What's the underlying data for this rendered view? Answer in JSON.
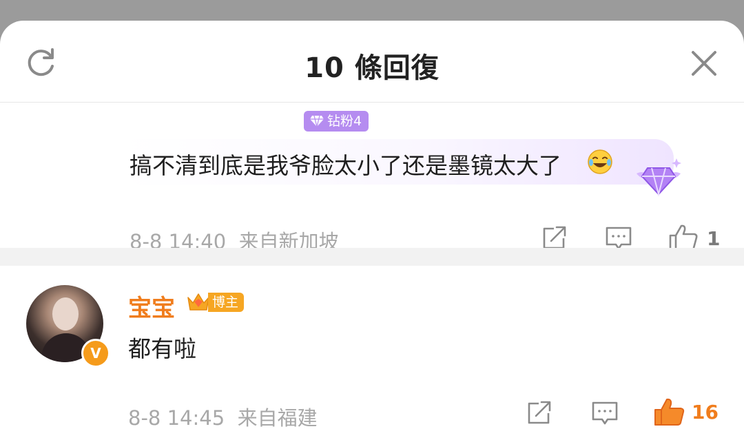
{
  "header": {
    "title": "10 條回復",
    "refresh_icon": "refresh-icon",
    "close_icon": "close-icon"
  },
  "reply": {
    "fan_badge": "钻粉4",
    "text": "搞不清到底是我爷脸太小了还是墨镜太大了",
    "emoji": "laughing-tears-emoji",
    "timestamp": "8-8 14:40",
    "location": "来自新加坡",
    "like_count": "1"
  },
  "comment": {
    "username": "宝宝",
    "badge_label": "博主",
    "verified_badge": "V",
    "text": "都有啦",
    "timestamp": "8-8 14:45",
    "location": "来自福建",
    "like_count": "16"
  },
  "colors": {
    "accent_orange": "#f07d1d",
    "fan_purple": "#b58cf0",
    "meta_gray": "#a8a8a8"
  }
}
